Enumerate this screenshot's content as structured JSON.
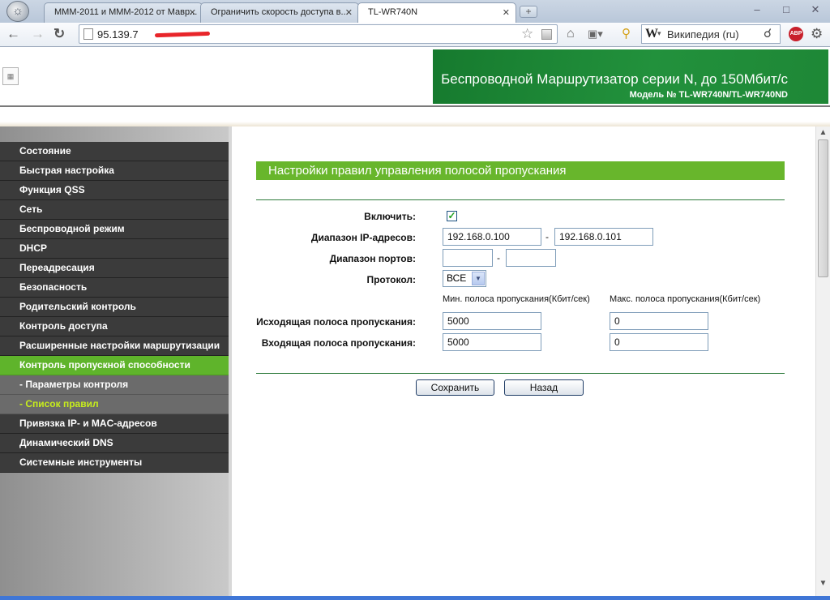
{
  "browser": {
    "tabs": [
      {
        "title": "МММ-2011 и МММ-2012 от Мавр..."
      },
      {
        "title": "Ограничить скорость доступа в..."
      },
      {
        "title": "TL-WR740N"
      }
    ],
    "url": "95.139.7",
    "search_engine_placeholder": "Википедия (ru)",
    "search_engine_letter": "W",
    "abp_label": "ABP"
  },
  "header": {
    "product_title": "Беспроводной Маршрутизатор серии N, до 150Мбит/с",
    "model": "Модель № TL-WR740N/TL-WR740ND"
  },
  "sidebar": {
    "items": [
      {
        "label": "Состояние"
      },
      {
        "label": "Быстрая настройка"
      },
      {
        "label": "Функция QSS"
      },
      {
        "label": "Сеть"
      },
      {
        "label": "Беспроводной режим"
      },
      {
        "label": "DHCP"
      },
      {
        "label": "Переадресация"
      },
      {
        "label": "Безопасность"
      },
      {
        "label": "Родительский контроль"
      },
      {
        "label": "Контроль доступа"
      },
      {
        "label": "Расширенные настройки маршрутизации"
      },
      {
        "label": "Контроль пропускной способности"
      },
      {
        "label": "- Параметры контроля"
      },
      {
        "label": "- Список правил"
      },
      {
        "label": "Привязка IP- и MAC-адресов"
      },
      {
        "label": "Динамический DNS"
      },
      {
        "label": "Системные инструменты"
      }
    ]
  },
  "form": {
    "title": "Настройки правил управления полосой пропускания",
    "enable_label": "Включить:",
    "enable_checked": true,
    "ip_range_label": "Диапазон IP-адресов:",
    "ip_start": "192.168.0.100",
    "ip_end": "192.168.0.101",
    "port_range_label": "Диапазон портов:",
    "port_start": "",
    "port_end": "",
    "protocol_label": "Протокол:",
    "protocol_value": "ВСЕ",
    "min_bw_header": "Мин. полоса пропускания(Кбит/сек)",
    "max_bw_header": "Макс. полоса пропускания(Кбит/сек)",
    "egress_label": "Исходящая полоса пропускания:",
    "egress_min": "5000",
    "egress_max": "0",
    "ingress_label": "Входящая полоса пропускания:",
    "ingress_min": "5000",
    "ingress_max": "0",
    "range_separator": "-",
    "save_label": "Сохранить",
    "back_label": "Назад"
  }
}
